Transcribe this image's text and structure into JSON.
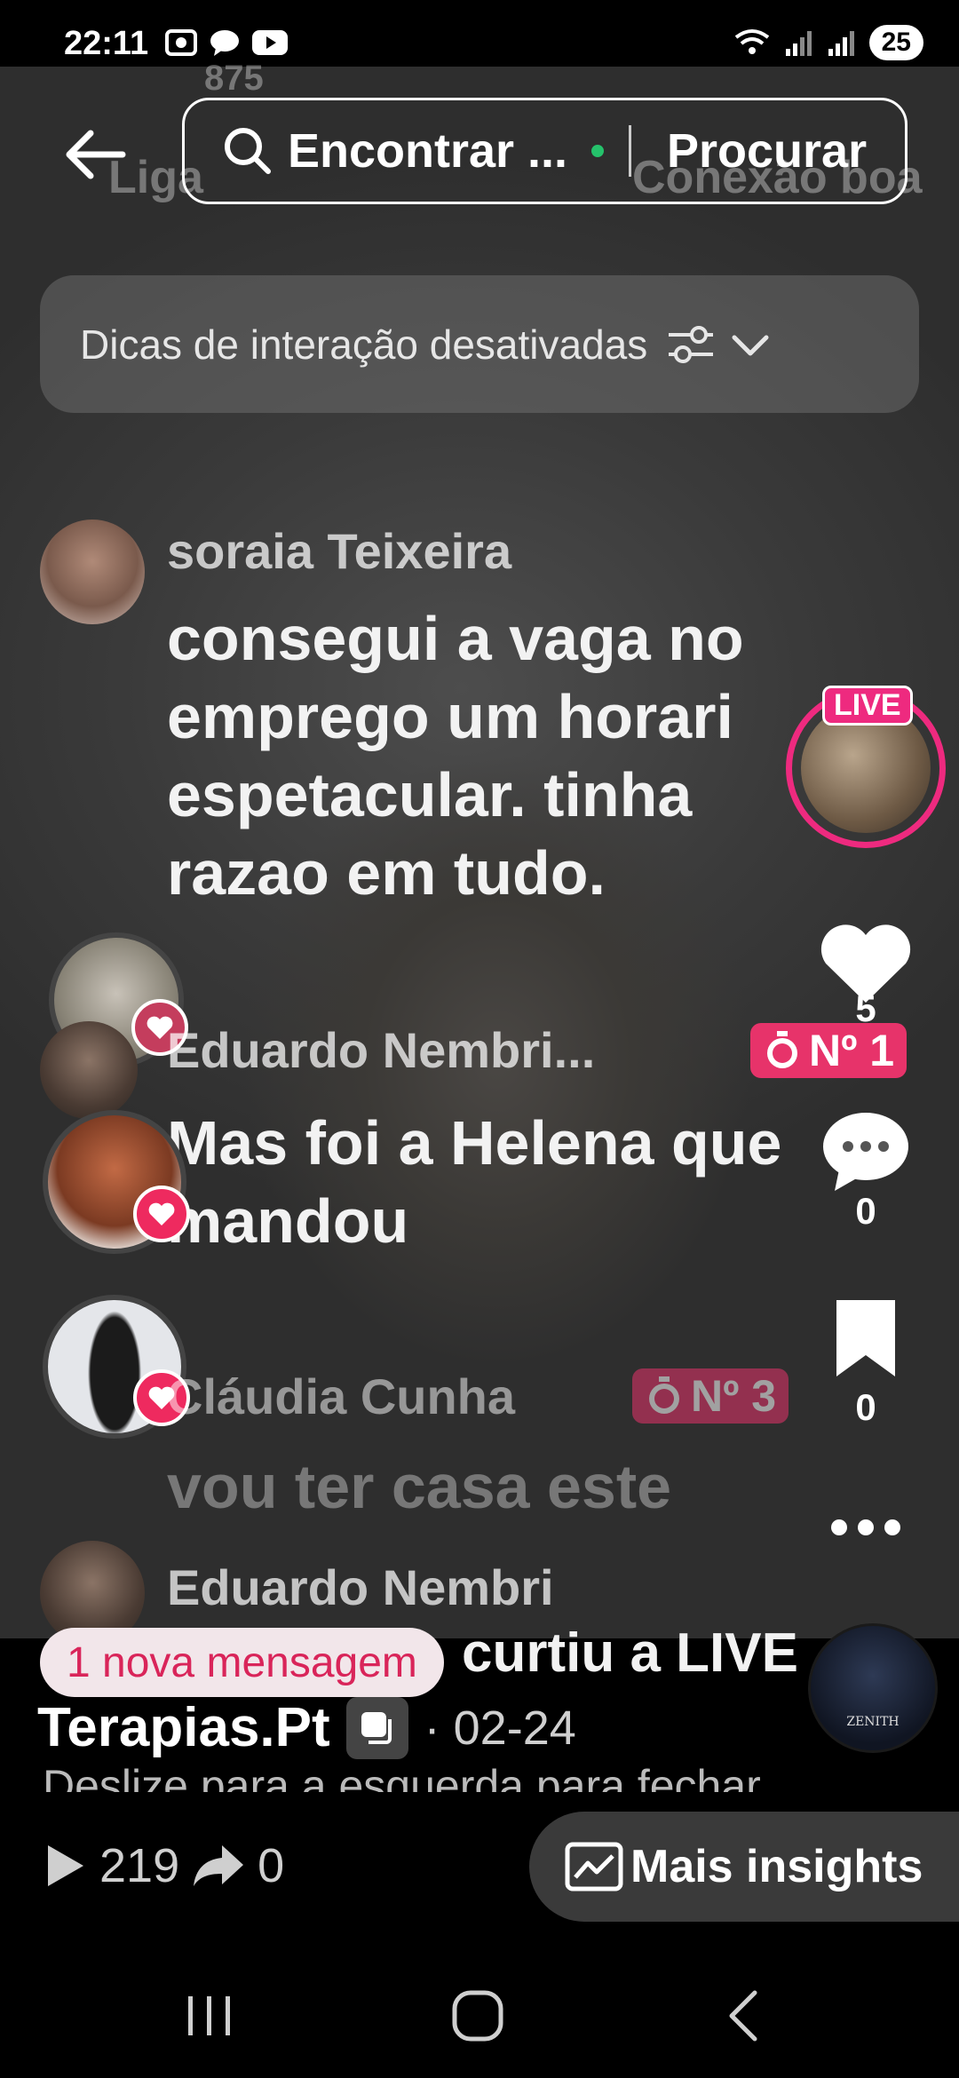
{
  "status_bar": {
    "time": "22:11",
    "battery": "25"
  },
  "top": {
    "search_text": "Encontrar ...",
    "search_button": "Procurar",
    "ghost_left": "Liga",
    "ghost_right": "Conexão boa",
    "ghost_top": "875"
  },
  "tips": {
    "label": "Dicas de interação desativadas"
  },
  "comments": [
    {
      "name": "soraia Teixeira",
      "lines": [
        "consegui a vaga no",
        "emprego um horari",
        "espetacular.  tinha",
        "razao em tudo."
      ]
    },
    {
      "name": "Eduardo Nembri...",
      "rank": "Nº 1",
      "lines": [
        "Mas foi a Helena que",
        "mandou"
      ]
    },
    {
      "name": "Cláudia Cunha",
      "rank": "Nº 3",
      "lines": [
        "vou ter casa este"
      ]
    },
    {
      "name": "Eduardo Nembri",
      "lines": [
        "curtiu a LIVE"
      ]
    }
  ],
  "live_badge": "LIVE",
  "rail": {
    "likes": "5",
    "comments": "0",
    "saves": "0"
  },
  "bottom": {
    "new_message": "1 nova mensagem",
    "channel": "Terapias.Pt",
    "date": "· 02-24",
    "hint": "Deslize para a esquerda para fechar",
    "album_label": "ZENITH",
    "plays": "219",
    "shares": "0",
    "insights": "Mais insights"
  }
}
